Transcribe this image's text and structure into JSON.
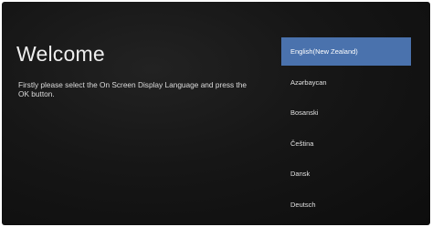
{
  "welcome": {
    "title": "Welcome",
    "instruction": "Firstly please select the On Screen Display Language and press the OK button."
  },
  "languages": {
    "selected_index": 0,
    "items": [
      {
        "label": "English(New Zealand)"
      },
      {
        "label": "Azərbaycan"
      },
      {
        "label": "Bosanski"
      },
      {
        "label": "Čeština"
      },
      {
        "label": "Dansk"
      },
      {
        "label": "Deutsch"
      }
    ]
  },
  "colors": {
    "background": "#161616",
    "selected_highlight": "#4a72ad",
    "text": "#e6e6e6"
  }
}
